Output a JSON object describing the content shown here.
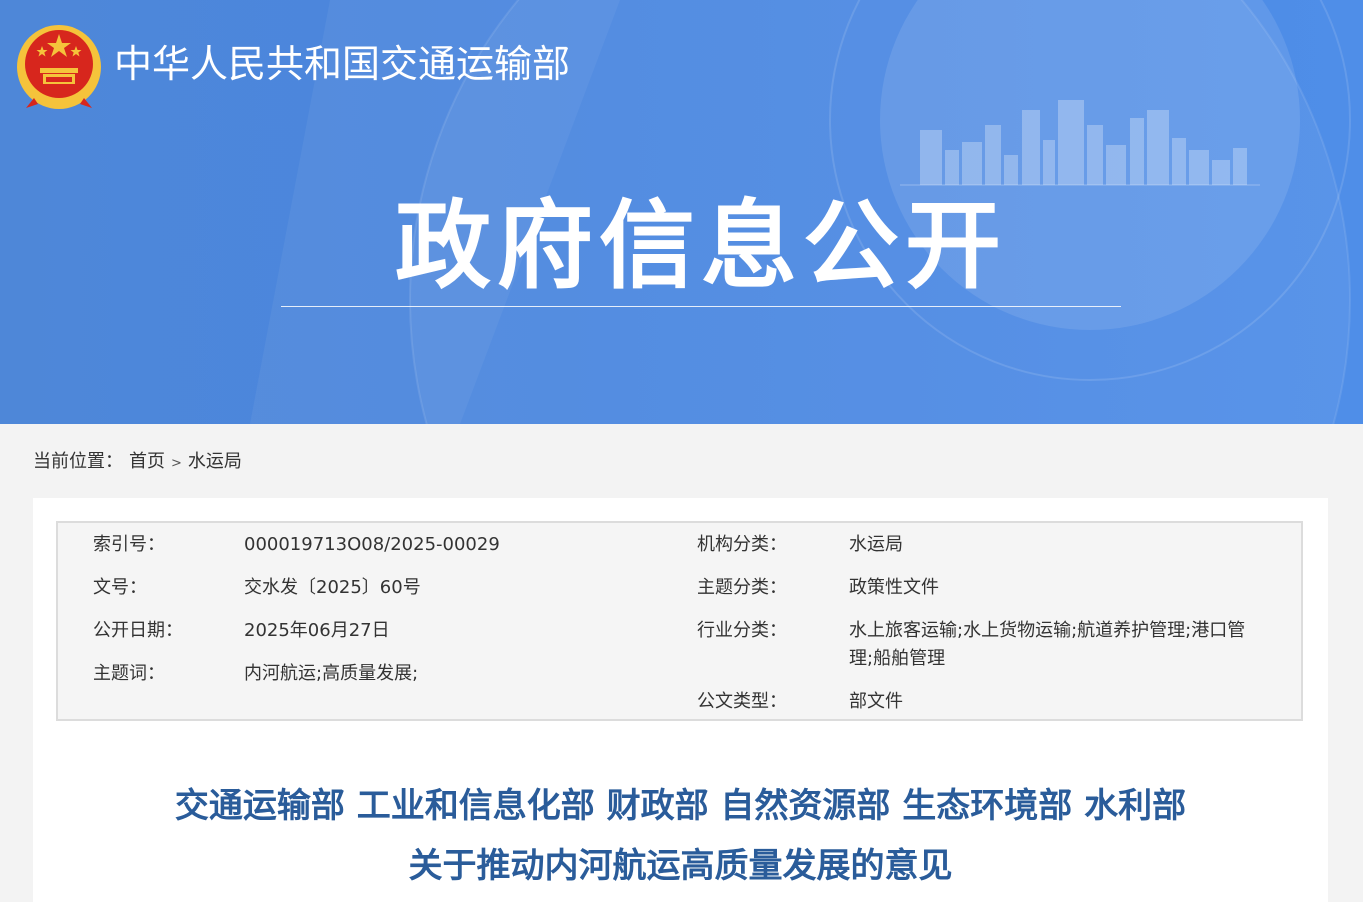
{
  "header": {
    "ministry_name": "中华人民共和国交通运输部",
    "banner_title": "政府信息公开"
  },
  "breadcrumb": {
    "label": "当前位置：",
    "home": "首页",
    "separator": ">",
    "current": "水运局"
  },
  "meta": {
    "left": [
      {
        "label": "索引号：",
        "value": "000019713O08/2025-00029"
      },
      {
        "label": "文号：",
        "value": "交水发〔2025〕60号"
      },
      {
        "label": "公开日期：",
        "value": "2025年06月27日"
      },
      {
        "label": "主题词：",
        "value": "内河航运;高质量发展;"
      }
    ],
    "right": [
      {
        "label": "机构分类：",
        "value": "水运局"
      },
      {
        "label": "主题分类：",
        "value": "政策性文件"
      },
      {
        "label": "行业分类：",
        "value": "水上旅客运输;水上货物运输;航道养护管理;港口管理;船舶管理"
      },
      {
        "label": "公文类型：",
        "value": "部文件"
      }
    ]
  },
  "document": {
    "title_line1": "交通运输部 工业和信息化部 财政部 自然资源部 生态环境部 水利部",
    "title_line2": "关于推动内河航运高质量发展的意见"
  },
  "colors": {
    "banner_blue": "#4a86e0",
    "title_blue": "#2a5c9a",
    "emblem_red": "#d7261d",
    "emblem_gold": "#f5c33b"
  }
}
